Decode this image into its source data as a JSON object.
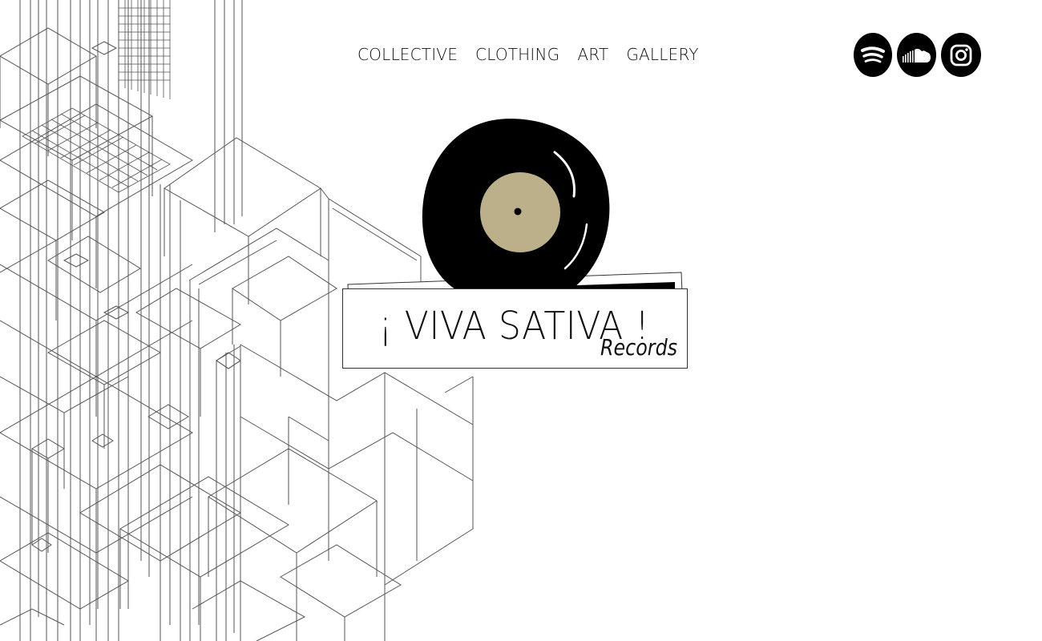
{
  "nav": {
    "items": [
      {
        "label": "COLLECTIVE"
      },
      {
        "label": "CLOTHING"
      },
      {
        "label": "ART"
      },
      {
        "label": "GALLERY"
      }
    ]
  },
  "social": {
    "icons": [
      "spotify-icon",
      "soundcloud-icon",
      "instagram-icon"
    ]
  },
  "logo": {
    "title": "¡ VIVA SATIVA !",
    "subtitle": "Records",
    "label_color": "#bcb08b"
  },
  "colors": {
    "background": "#ffffff",
    "ink": "#000000",
    "line_art": "#555555"
  }
}
